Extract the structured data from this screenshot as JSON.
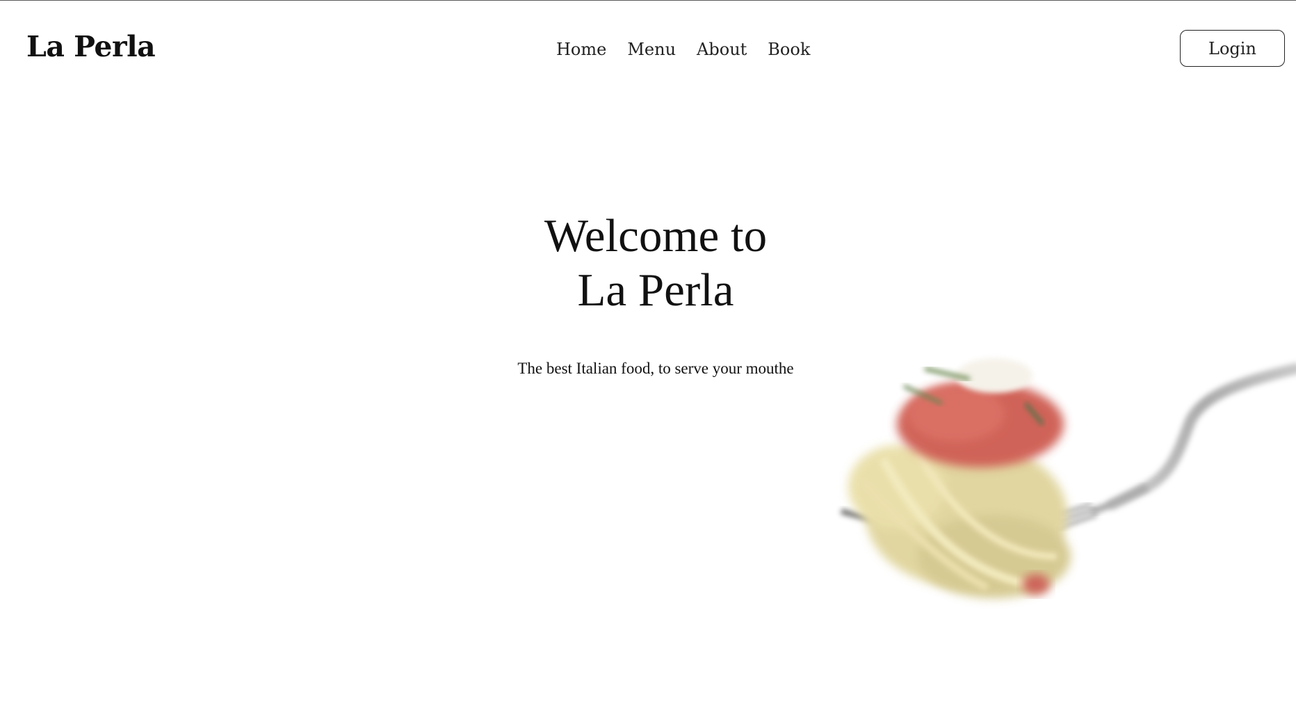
{
  "navbar": {
    "brand": "La Perla",
    "links": [
      "Home",
      "Menu",
      "About",
      "Book"
    ],
    "login_label": "Login"
  },
  "hero": {
    "title_line1": "Welcome to",
    "title_line2": "La Perla",
    "subtitle": "The best Italian food, to serve your mouthe"
  },
  "colors": {
    "background": "#ffffff",
    "text": "#111111",
    "sauce": "#c8473a",
    "pasta": "#dccf8f",
    "fork": "#a7a7a7"
  },
  "image": {
    "subject": "fork-with-pasta-image"
  }
}
